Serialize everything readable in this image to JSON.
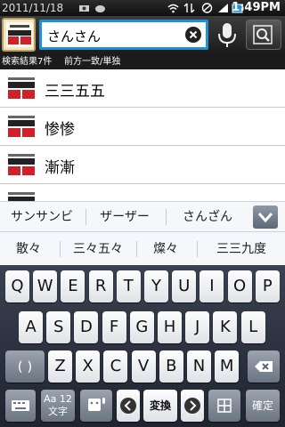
{
  "status_bar": {
    "date": "2011/11/18",
    "time": "1:49PM"
  },
  "search": {
    "query": "さんさん"
  },
  "info": {
    "result_count": "検索結果7件",
    "match_mode": "前方一致/単独"
  },
  "app": {
    "logo_text_top": "KANGORIN",
    "logo_text_mid": "新漢語林",
    "logo_text_bottom": "MX"
  },
  "results": [
    {
      "word": "三三五五"
    },
    {
      "word": "惨惨"
    },
    {
      "word": "漸漸"
    },
    {
      "word": "……"
    }
  ],
  "candidates_row1": [
    "サンサンビ",
    "ザーザー",
    "さんざん"
  ],
  "candidates_row2": [
    "散々",
    "三々五々",
    "燦々",
    "三三九度"
  ],
  "keyboard": {
    "row1": [
      "Q",
      "W",
      "E",
      "R",
      "T",
      "Y",
      "U",
      "I",
      "O",
      "P"
    ],
    "row2": [
      "A",
      "S",
      "D",
      "F",
      "G",
      "H",
      "J",
      "K",
      "L"
    ],
    "row3_left": "( )",
    "row3": [
      "Z",
      "X",
      "C",
      "V",
      "B",
      "N",
      "M"
    ],
    "row4": {
      "mode_label": "Aa 12",
      "mode_sub": "文字",
      "convert": "変換",
      "enter": "確定"
    }
  },
  "colors": {
    "accent": "#1f8fd8"
  }
}
